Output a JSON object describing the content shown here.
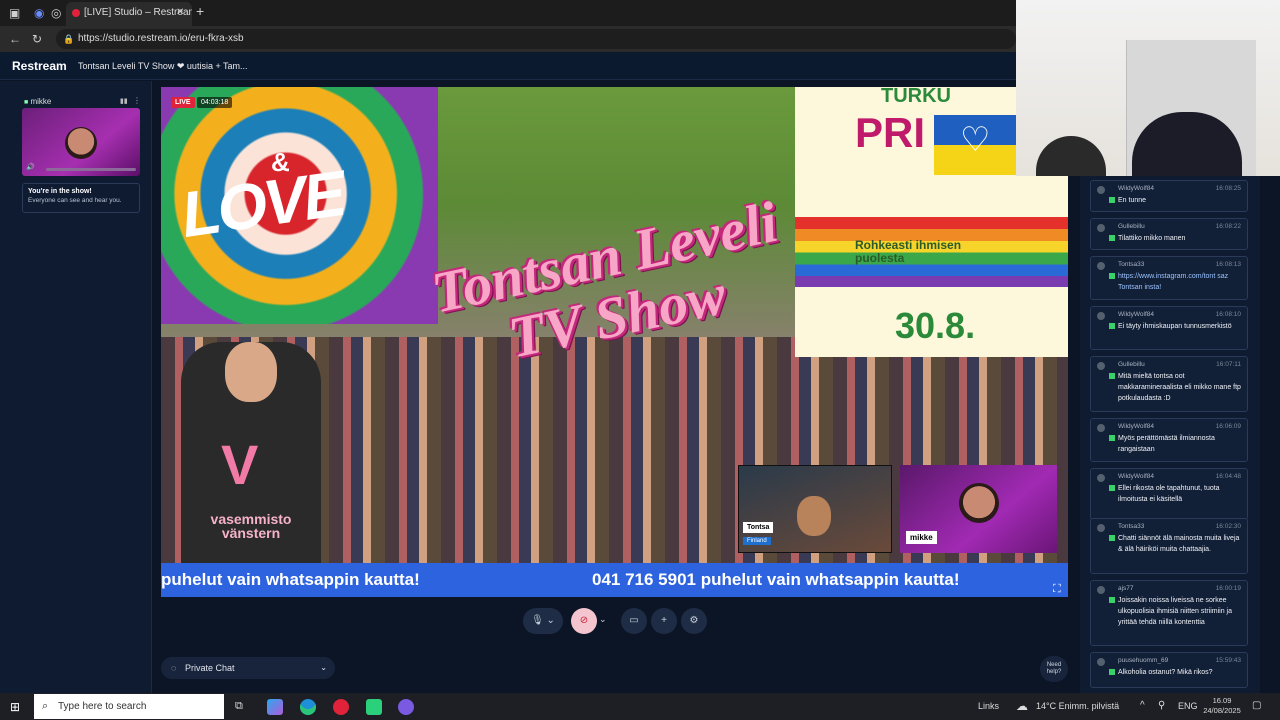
{
  "browser": {
    "tab_title": "[LIVE] Studio – Restream",
    "url": "https://studio.restream.io/eru-fkra-xsb",
    "new_tab_icon": "plus-icon"
  },
  "app": {
    "logo": "Restream",
    "show_title": "Tontsan Leveli TV Show ❤ uutisia + Tam..."
  },
  "left_panel": {
    "preview_name": "mikke",
    "in_show_title": "You're in the show!",
    "in_show_text": "Everyone can see and hear you."
  },
  "stage": {
    "live_label": "LIVE",
    "timer": "04:03:18",
    "logo_line1": "Tontsan Leveli",
    "logo_line2": "TV Show",
    "love_text": "LOVE",
    "love_small": "&",
    "pride_turku": "TURKU",
    "pride_title": "PRI",
    "pride_date": "30.8.",
    "pride_banner": "Rohkeasti ihmisen puolesta",
    "person_logo1": "vasemmisto",
    "person_logo2": "vänstern",
    "cam1_name": "Tontsa",
    "cam1_sub": "Finland",
    "cam2_name": "mikke",
    "ticker_a": "puhelut vain whatsappin kautta!",
    "ticker_b": "041 716 5901 puhelut vain whatsappin kautta!"
  },
  "controls": {
    "private_chat": "Private Chat",
    "need_help_1": "Need",
    "need_help_2": "help?"
  },
  "chat": [
    {
      "user": "WildyWolf84",
      "time": "16:08:25",
      "text": "En tunne"
    },
    {
      "user": "Gullebillu",
      "time": "16:08:22",
      "text": "Tilattiko mikko manen"
    },
    {
      "user": "Tontsa33",
      "time": "16:08:13",
      "text": "https://www.instagram.com/tont saz Tontsan insta!"
    },
    {
      "user": "WildyWolf84",
      "time": "16:08:10",
      "text": "Ei täyty ihmiskaupan tunnusmerkistö"
    },
    {
      "user": "Gullebillu",
      "time": "16:07:11",
      "text": "Mitä mieltä tontsa oot makkaramineraalista eli mikko mane ftp potkulaudasta :D"
    },
    {
      "user": "WildyWolf84",
      "time": "16:06:09",
      "text": "Myös perättömästä ilmiannosta rangaistaan"
    },
    {
      "user": "WildyWolf84",
      "time": "16:04:48",
      "text": "Ellei rikosta ole tapahtunut, tuota ilmoitusta ei käsitellä"
    },
    {
      "user": "Tontsa33",
      "time": "16:02:30",
      "text": "Chatti siännöt älä mainosta muita liveja & älä häiriköi muita chattaajia."
    },
    {
      "user": "ajs77",
      "time": "16:00:19",
      "text": "Joissakin noissa liveissä ne sorkee ulkopuolisia ihmisiä niitten striimiin ja yrittää tehdä niillä kontenttia"
    },
    {
      "user": "puusehuomm_69",
      "time": "15:59:43",
      "text": "Alkoholia ostanut? Mikä rikos?"
    }
  ],
  "taskbar": {
    "search_placeholder": "Type here to search",
    "links": "Links",
    "weather": "14°C  Enimm. pilvistä",
    "lang": "ENG",
    "time": "16.09",
    "date": "24/08/2025"
  },
  "colors": {
    "accent": "#2e63df",
    "live": "#e0233a",
    "panel": "#0e1b31"
  }
}
